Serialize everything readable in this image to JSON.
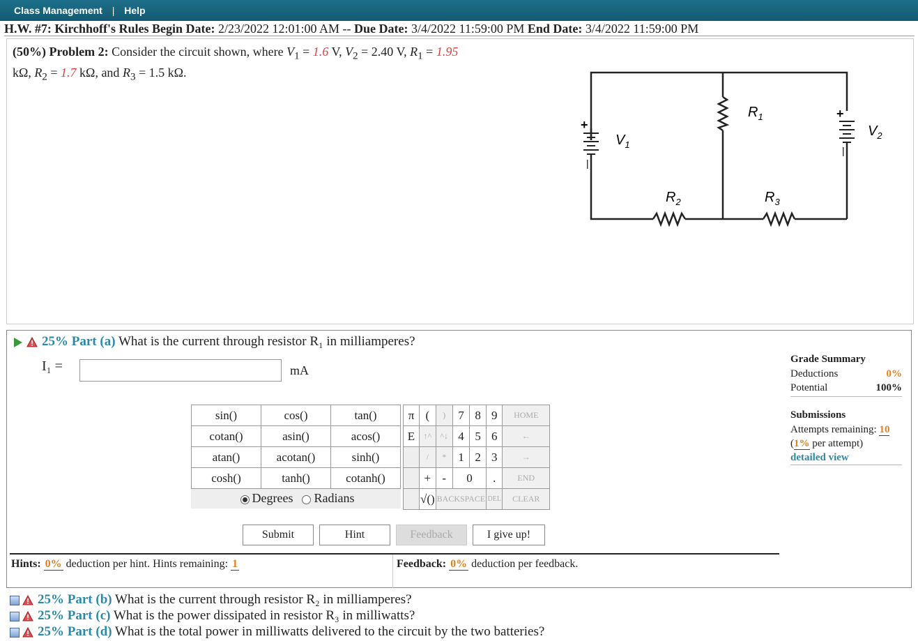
{
  "nav": {
    "class_mgmt": "Class Management",
    "sep": "|",
    "help": "Help"
  },
  "hw": {
    "title": "H.W. #7: Kirchhoff's Rules",
    "begin_label": "Begin Date:",
    "begin": "2/23/2022 12:01:00 AM",
    "dash": "--",
    "due_label": "Due Date:",
    "due": "3/4/2022 11:59:00 PM",
    "end_label": "End Date:",
    "end": "3/4/2022 11:59:00 PM"
  },
  "problem": {
    "weight": "(50%)",
    "label": "Problem 2:",
    "text_a": "Consider the circuit shown, where",
    "v1_value": "1.6",
    "v2_value": "2.40",
    "r1_value": "1.95",
    "r2_value": "1.7",
    "r3_value": "1.5",
    "unit_v": "V",
    "unit_k": "kΩ"
  },
  "circuit": {
    "labels": [
      "R1",
      "V1",
      "V2",
      "R2",
      "R3"
    ]
  },
  "part_a": {
    "percent": "25%",
    "name": "Part (a)",
    "question": "What is the current through resistor R₁ in milliamperes?",
    "var": "I₁ =",
    "unit": "mA",
    "value": ""
  },
  "keypad": {
    "functions": [
      [
        "sin()",
        "cos()",
        "tan()"
      ],
      [
        "cotan()",
        "asin()",
        "acos()"
      ],
      [
        "atan()",
        "acotan()",
        "sinh()"
      ],
      [
        "cosh()",
        "tanh()",
        "cotanh()"
      ]
    ],
    "degrees": "Degrees",
    "radians": "Radians",
    "right_rows": [
      [
        "π",
        "(",
        ")",
        "7",
        "8",
        "9",
        "HOME"
      ],
      [
        "E",
        "↑^",
        "^↓",
        "4",
        "5",
        "6",
        "←"
      ],
      [
        "",
        "/",
        "*",
        "1",
        "2",
        "3",
        "→"
      ],
      [
        "",
        "+",
        "-",
        "0",
        ".",
        "END"
      ]
    ],
    "sqrt": "√()",
    "backspace": "BACKSPACE",
    "del": "DEL",
    "clear": "CLEAR"
  },
  "buttons": {
    "submit": "Submit",
    "hint": "Hint",
    "feedback": "Feedback",
    "giveup": "I give up!"
  },
  "hints": {
    "label": "Hints:",
    "deduction": "0%",
    "text": "deduction per hint. Hints remaining:",
    "remaining": "1"
  },
  "feedback": {
    "label": "Feedback:",
    "deduction": "0%",
    "text": "deduction per feedback."
  },
  "grade": {
    "title": "Grade Summary",
    "deductions_label": "Deductions",
    "deductions": "0%",
    "potential_label": "Potential",
    "potential": "100%",
    "submissions_title": "Submissions",
    "attempts_label": "Attempts remaining:",
    "attempts": "10",
    "per_attempt_pct": "1%",
    "per_attempt_text": "per attempt)",
    "detailed": "detailed view"
  },
  "other_parts": [
    {
      "percent": "25%",
      "name": "Part (b)",
      "question": "What is the current through resistor R₂ in milliamperes?"
    },
    {
      "percent": "25%",
      "name": "Part (c)",
      "question": "What is the power dissipated in resistor R₃ in milliwatts?"
    },
    {
      "percent": "25%",
      "name": "Part (d)",
      "question": "What is the total power in milliwatts delivered to the circuit by the two batteries?"
    }
  ]
}
